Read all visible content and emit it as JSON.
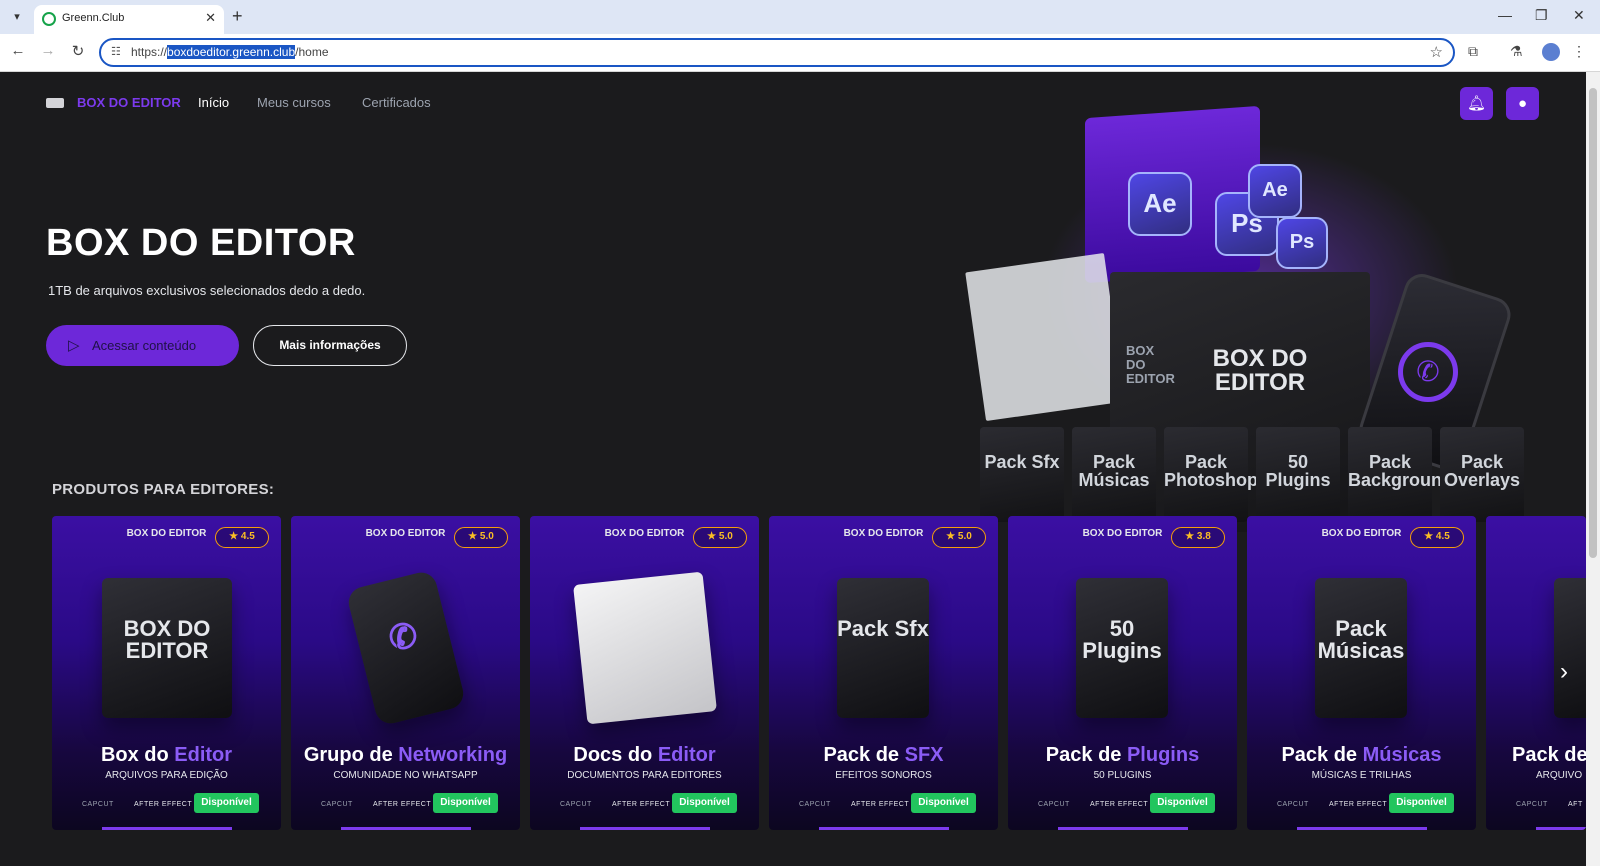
{
  "browser": {
    "tab_title": "Greenn.Club",
    "url_prefix": "https://",
    "url_host": "boxdoeditor.greenn.club",
    "url_path": "/home"
  },
  "nav": {
    "brand": "BOX DO EDITOR",
    "links": [
      "Início",
      "Meus cursos",
      "Certificados"
    ]
  },
  "hero": {
    "title": "BOX DO EDITOR",
    "subtitle": "1TB de arquivos exclusivos selecionados dedo a dedo.",
    "primary_button": "Acessar conteúdo",
    "secondary_button": "Mais informações",
    "box_label": "BOX DO EDITOR",
    "box_side_label": "BOX DO EDITOR",
    "app_badges": [
      "Ae",
      "Ps",
      "Ae",
      "Ps"
    ],
    "mini_packs": [
      "Pack Sfx",
      "Pack Músicas",
      "Pack Photoshop",
      "50 Plugins",
      "Pack Backgrounds",
      "Pack Overlays"
    ]
  },
  "section": {
    "title": "PRODUTOS PARA EDITORES:"
  },
  "cards": [
    {
      "logo": "BOX DO EDITOR",
      "rating": "4.5",
      "art": "BOX DO EDITOR",
      "title_a": "Box do ",
      "title_b": "Editor",
      "subtitle": "ARQUIVOS PARA EDIÇÃO",
      "tag1": "CAPCUT",
      "tag2": "AFTER EFFECT",
      "status": "Disponível"
    },
    {
      "logo": "BOX DO EDITOR",
      "rating": "5.0",
      "art": "✆",
      "title_a": "Grupo de ",
      "title_b": "Networking",
      "subtitle": "COMUNIDADE NO WHATSAPP",
      "tag1": "CAPCUT",
      "tag2": "AFTER EFFECT",
      "status": "Disponível"
    },
    {
      "logo": "BOX DO EDITOR",
      "rating": "5.0",
      "art": "",
      "title_a": "Docs do ",
      "title_b": "Editor",
      "subtitle": "DOCUMENTOS PARA EDITORES",
      "tag1": "CAPCUT",
      "tag2": "AFTER EFFECT",
      "status": "Disponível"
    },
    {
      "logo": "BOX DO EDITOR",
      "rating": "5.0",
      "art": "Pack Sfx",
      "title_a": "Pack de ",
      "title_b": "SFX",
      "subtitle": "EFEITOS SONOROS",
      "tag1": "CAPCUT",
      "tag2": "AFTER EFFECT",
      "status": "Disponível"
    },
    {
      "logo": "BOX DO EDITOR",
      "rating": "3.8",
      "art": "50 Plugins",
      "title_a": "Pack de ",
      "title_b": "Plugins",
      "subtitle": "50 PLUGINS",
      "tag1": "CAPCUT",
      "tag2": "AFTER EFFECT",
      "status": "Disponível"
    },
    {
      "logo": "BOX DO EDITOR",
      "rating": "4.5",
      "art": "Pack Músicas",
      "title_a": "Pack de ",
      "title_b": "Músicas",
      "subtitle": "MÚSICAS E TRILHAS",
      "tag1": "CAPCUT",
      "tag2": "AFTER EFFECT",
      "status": "Disponível"
    },
    {
      "logo": "",
      "rating": "",
      "art": "",
      "title_a": "Pack de",
      "title_b": "",
      "subtitle": "ARQUIVO",
      "tag1": "CAPCUT",
      "tag2": "AFT",
      "status": ""
    }
  ],
  "colors": {
    "accent": "#6d28d9",
    "status_green": "#22c55e",
    "rating_gold": "#f59e0b",
    "page_bg": "#1b1b1d"
  }
}
